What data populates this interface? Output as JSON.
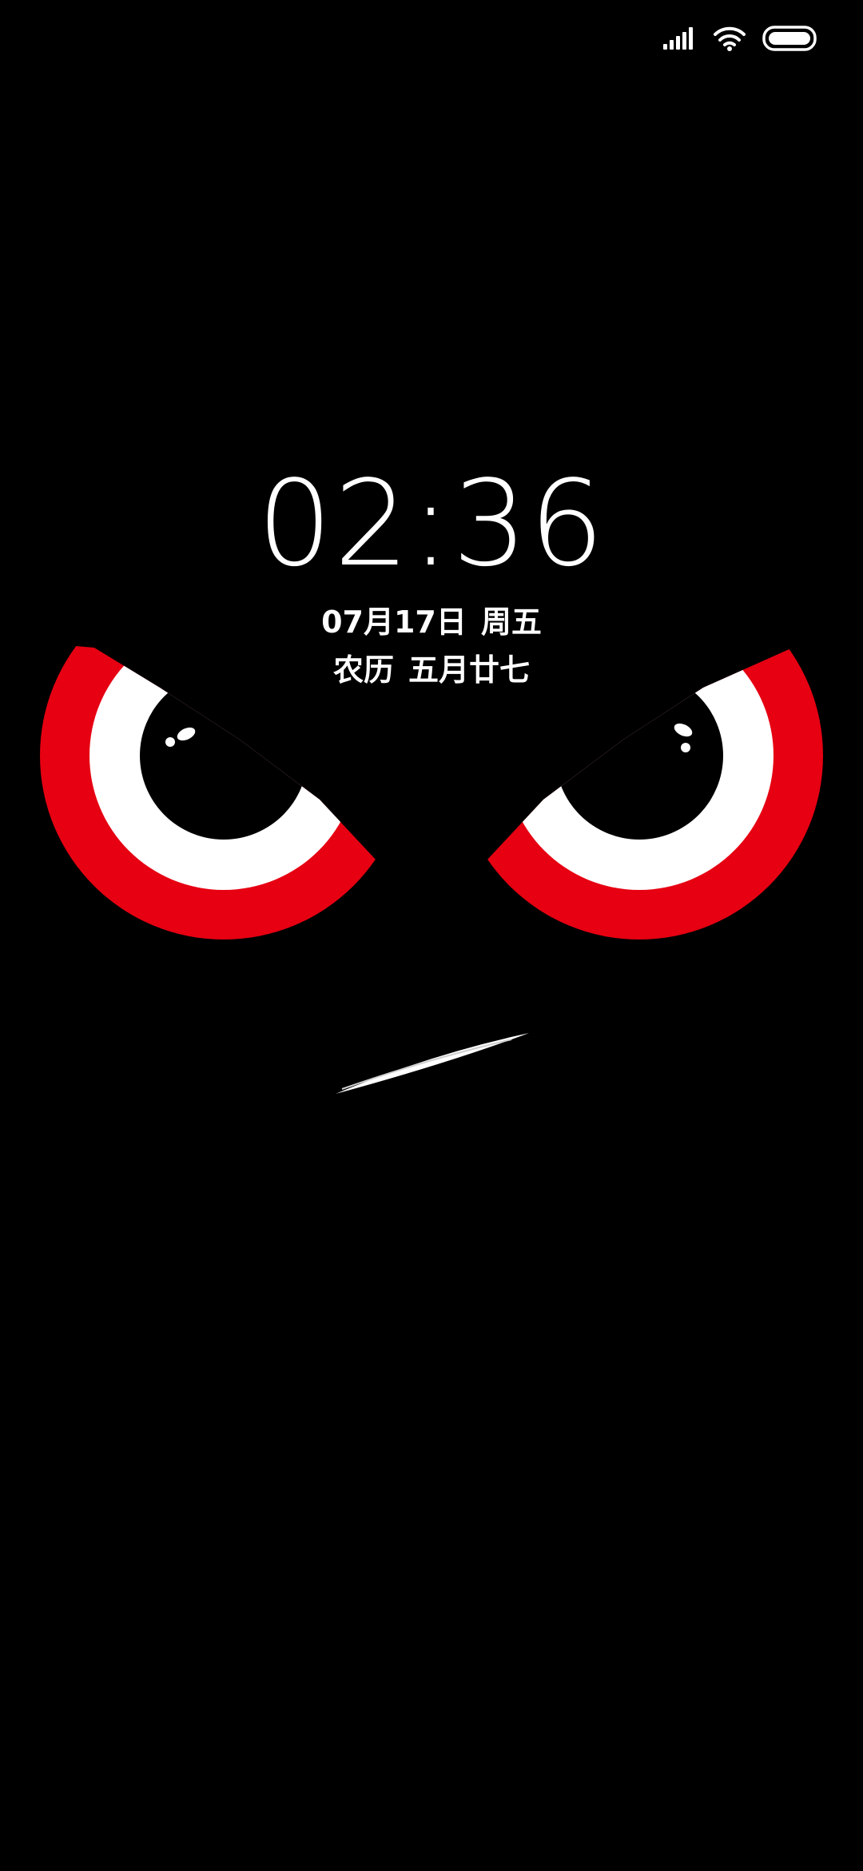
{
  "lockscreen": {
    "time": "02:36",
    "date": "07月17日",
    "weekday": "周五",
    "lunar_label": "农历",
    "lunar_date": "五月廿七"
  },
  "status_bar": {
    "icons": [
      "signal-icon",
      "wifi-icon",
      "battery-icon"
    ]
  },
  "colors": {
    "background": "#000000",
    "text": "#ffffff",
    "eye_red": "#e60012",
    "eye_white": "#ffffff"
  }
}
